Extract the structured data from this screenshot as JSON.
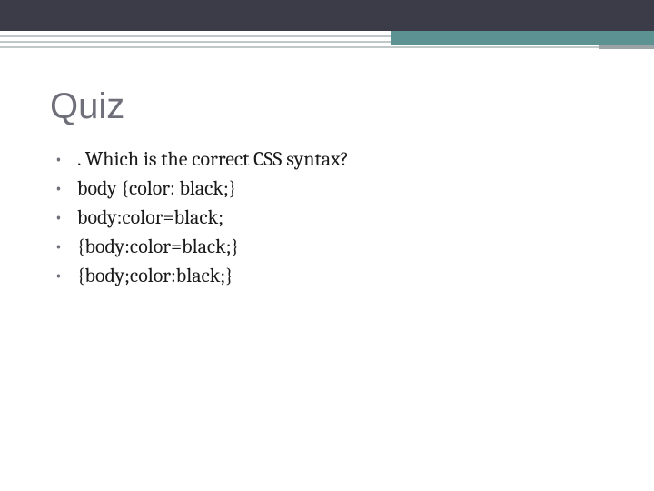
{
  "title": "Quiz",
  "bullets": [
    ". Which is the correct CSS syntax?",
    "body {color: black;}",
    "body:color=black;",
    "{body:color=black;}",
    "{body;color:black;}"
  ]
}
